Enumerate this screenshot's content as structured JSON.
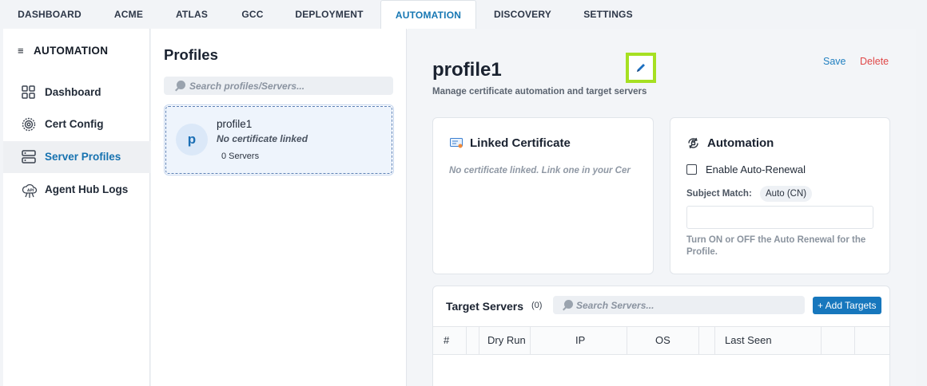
{
  "topnav": {
    "tabs": [
      {
        "label": "DASHBOARD"
      },
      {
        "label": "ACME"
      },
      {
        "label": "ATLAS"
      },
      {
        "label": "GCC"
      },
      {
        "label": "DEPLOYMENT"
      },
      {
        "label": "AUTOMATION"
      },
      {
        "label": "DISCOVERY"
      },
      {
        "label": "SETTINGS"
      }
    ],
    "active": "AUTOMATION"
  },
  "sidebar": {
    "title": "AUTOMATION",
    "menu_icon": "hamburger-icon",
    "items": [
      {
        "label": "Dashboard",
        "icon": "grid-icon"
      },
      {
        "label": "Cert Config",
        "icon": "gear-cert-icon"
      },
      {
        "label": "Server Profiles",
        "icon": "server-icon",
        "active": true
      },
      {
        "label": "Agent Hub Logs",
        "icon": "api-hub-icon"
      }
    ]
  },
  "profiles": {
    "title": "Profiles",
    "search_placeholder": "Search profiles/Servers...",
    "list": [
      {
        "avatar": "p",
        "name": "profile1",
        "cert": "No certificate linked",
        "servers": "0 Servers"
      }
    ]
  },
  "main": {
    "title": "profile1",
    "subtitle": "Manage certificate automation and target servers",
    "save_label": "Save",
    "delete_label": "Delete",
    "edit_icon": "pencil-icon",
    "linked_cert": {
      "title": "Linked Certificate",
      "icon": "certificate-icon",
      "empty_text": "No certificate linked. Link one in your Cer"
    },
    "automation": {
      "title": "Automation",
      "icon": "auto-renew-icon",
      "renew_label": "Enable Auto-Renewal",
      "renew_checked": false,
      "subject_match_label": "Subject Match:",
      "subject_match_value": "Auto (CN)",
      "hint": "Turn ON or OFF the Auto Renewal for the Profile."
    },
    "targets": {
      "title": "Target Servers",
      "count": "(0)",
      "search_placeholder": "Search Servers...",
      "add_label": "+ Add Targets",
      "columns": [
        "#",
        "",
        "Dry Run",
        "IP",
        "OS",
        "",
        "Last Seen",
        "",
        ""
      ]
    }
  },
  "colors": {
    "accent": "#1677b3",
    "danger": "#e04848",
    "highlight": "#a6e022"
  }
}
